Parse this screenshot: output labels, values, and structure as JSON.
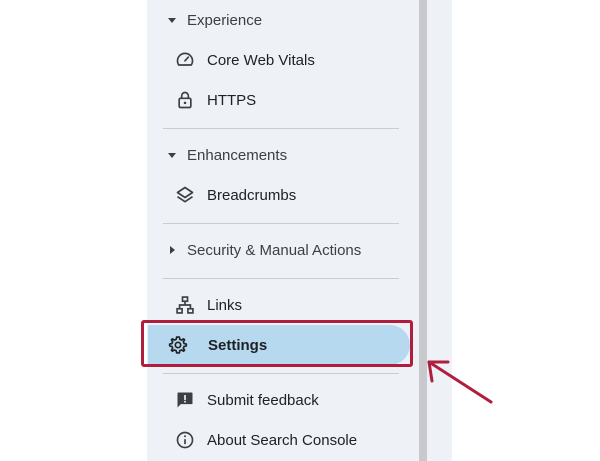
{
  "sidebar": {
    "sections": {
      "experience": {
        "label": "Experience",
        "expanded": true
      },
      "enhancements": {
        "label": "Enhancements",
        "expanded": true
      },
      "security": {
        "label": "Security & Manual Actions",
        "expanded": false
      }
    },
    "items": {
      "core_web_vitals": {
        "label": "Core Web Vitals",
        "icon": "speedometer-icon"
      },
      "https": {
        "label": "HTTPS",
        "icon": "lock-icon"
      },
      "breadcrumbs": {
        "label": "Breadcrumbs",
        "icon": "layers-icon"
      },
      "links": {
        "label": "Links",
        "icon": "sitemap-icon"
      },
      "settings": {
        "label": "Settings",
        "icon": "gear-icon",
        "active": true
      },
      "submit_feedback": {
        "label": "Submit feedback",
        "icon": "feedback-icon"
      },
      "about": {
        "label": "About Search Console",
        "icon": "info-icon"
      }
    }
  },
  "colors": {
    "sidebar_bg": "#eef2f6",
    "active_bg": "#b7d9ef",
    "annotation": "#b01e3e"
  }
}
